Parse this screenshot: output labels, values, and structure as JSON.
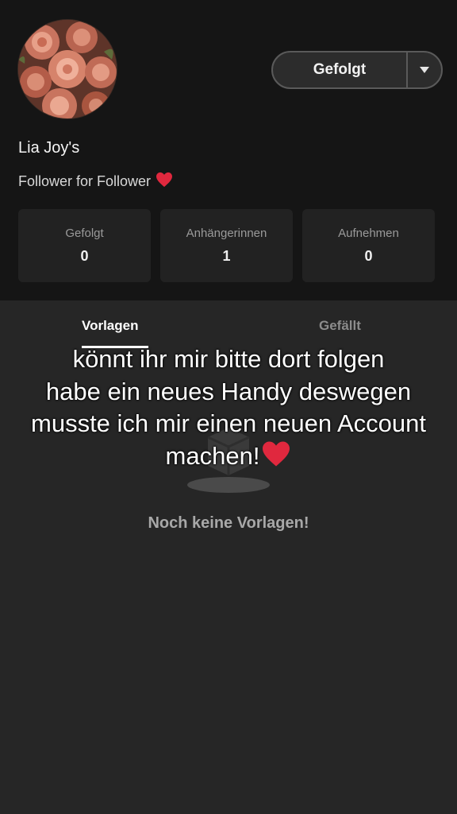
{
  "profile": {
    "name": "Lia Joy's",
    "bio": "Follower for Follower",
    "follow_button": {
      "label": "Gefolgt"
    }
  },
  "stats": [
    {
      "label": "Gefolgt",
      "value": "0"
    },
    {
      "label": "Anhängerinnen",
      "value": "1"
    },
    {
      "label": "Aufnehmen",
      "value": "0"
    }
  ],
  "tabs": [
    {
      "label": "Vorlagen",
      "active": true
    },
    {
      "label": "Gefällt",
      "active": false
    }
  ],
  "empty_state": {
    "message": "Noch keine Vorlagen!"
  },
  "overlay": {
    "lines": [
      "könnt ihr mir bitte dort folgen",
      "habe ein neues Handy deswegen",
      "musste ich mir einen neuen Account",
      "machen!"
    ]
  },
  "colors": {
    "header_bg": "#151515",
    "content_bg": "#262626",
    "heart": "#e0283e"
  },
  "icons": {
    "heart": "heart-icon",
    "dropdown": "caret-down-icon",
    "empty": "empty-box-icon"
  }
}
